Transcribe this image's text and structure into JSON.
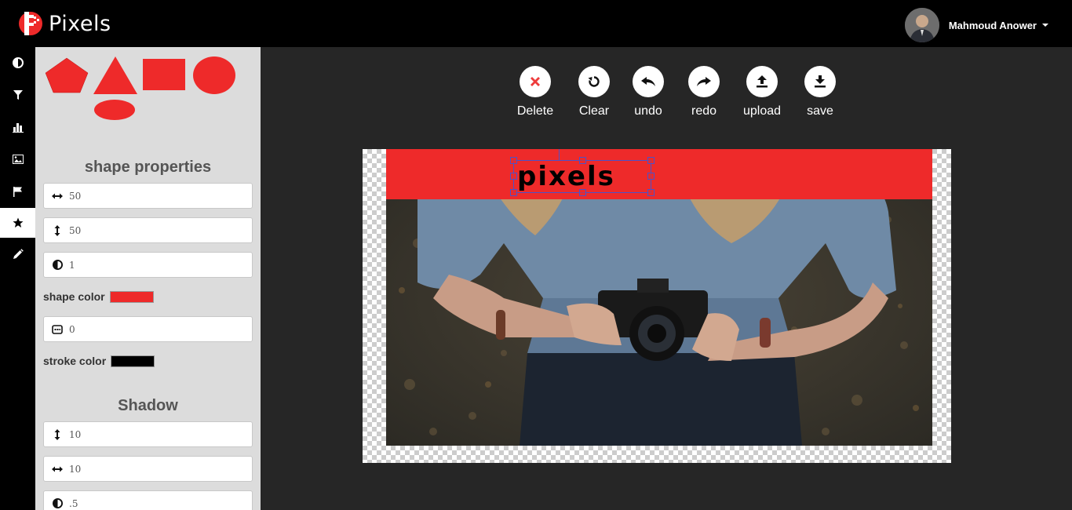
{
  "app": {
    "name": "Pixels",
    "brand_color": "#ee2a2a"
  },
  "user": {
    "name": "Mahmoud Anower"
  },
  "rail": {
    "items": [
      {
        "icon": "contrast-icon"
      },
      {
        "icon": "filter-icon"
      },
      {
        "icon": "bar-chart-icon"
      },
      {
        "icon": "image-icon"
      },
      {
        "icon": "flag-icon"
      },
      {
        "icon": "star-icon",
        "active": true
      },
      {
        "icon": "pencil-icon"
      }
    ]
  },
  "panel": {
    "shapes": [
      "pentagon",
      "triangle",
      "rectangle",
      "circle",
      "ellipse"
    ],
    "shape_properties": {
      "title": "shape properties",
      "width": "50",
      "height": "50",
      "opacity": "1",
      "shape_color_label": "shape color",
      "shape_color": "#ee2a2a",
      "stroke_width": "0",
      "stroke_color_label": "stroke color",
      "stroke_color": "#000000"
    },
    "shadow": {
      "title": "Shadow",
      "offset_y": "10",
      "offset_x": "10",
      "opacity": ".5"
    }
  },
  "toolbar": {
    "buttons": [
      {
        "label": "Delete",
        "icon": "delete-icon"
      },
      {
        "label": "Clear",
        "icon": "clear-icon"
      },
      {
        "label": "undo",
        "icon": "undo-icon"
      },
      {
        "label": "redo",
        "icon": "redo-icon"
      },
      {
        "label": "upload",
        "icon": "upload-icon"
      },
      {
        "label": "save",
        "icon": "save-icon"
      }
    ]
  },
  "canvas": {
    "text_object": "pixels",
    "banner_color": "#ee2a2a"
  }
}
